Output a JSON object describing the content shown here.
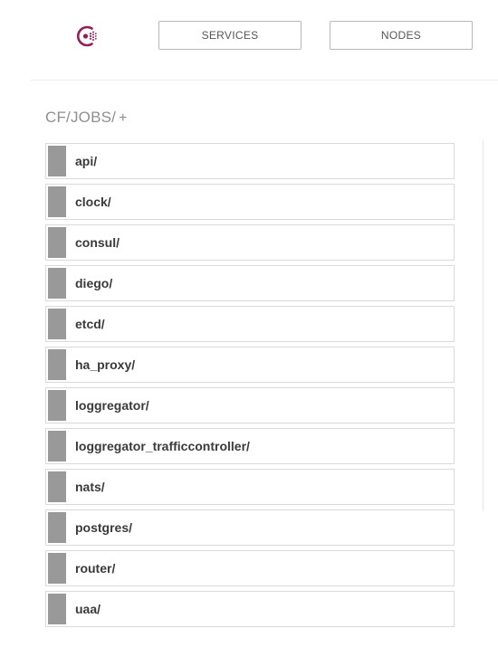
{
  "nav": {
    "logo_icon": "consul-logo-icon",
    "services_label": "SERVICES",
    "nodes_label": "NODES"
  },
  "breadcrumb": {
    "path": "CF/JOBS/",
    "add_label": "+"
  },
  "colors": {
    "logo": "#961d59",
    "row_marker": "#999999",
    "row_border": "#dadada",
    "breadcrumb": "#8f8f8f"
  },
  "items": [
    {
      "label": "api/"
    },
    {
      "label": "clock/"
    },
    {
      "label": "consul/"
    },
    {
      "label": "diego/"
    },
    {
      "label": "etcd/"
    },
    {
      "label": "ha_proxy/"
    },
    {
      "label": "loggregator/"
    },
    {
      "label": "loggregator_trafficcontroller/"
    },
    {
      "label": "nats/"
    },
    {
      "label": "postgres/"
    },
    {
      "label": "router/"
    },
    {
      "label": "uaa/"
    }
  ]
}
